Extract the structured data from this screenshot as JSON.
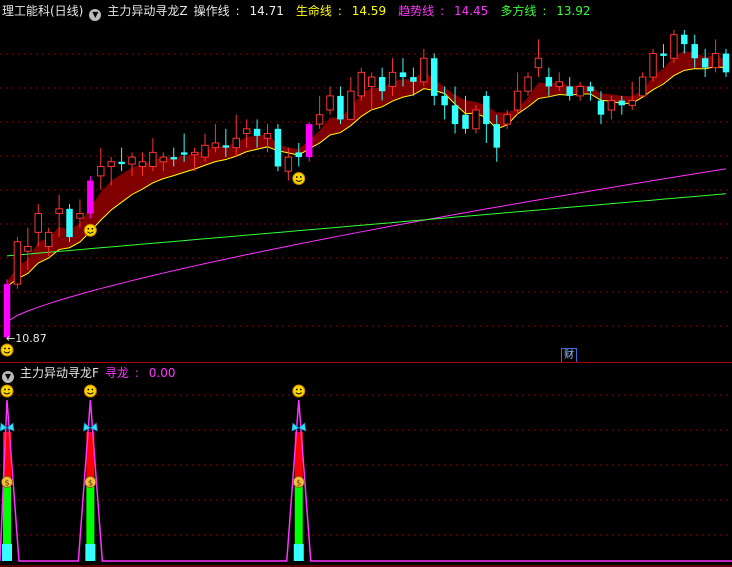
{
  "main_pane": {
    "title": "理工能科(日线)",
    "indicator_name": "主力异动寻龙Z",
    "lines": [
      {
        "label": "操作线",
        "value": "14.71",
        "color": "#f0f0f0"
      },
      {
        "label": "生命线",
        "value": "14.59",
        "color": "#ffff00"
      },
      {
        "label": "趋势线",
        "value": "14.45",
        "color": "#ff33ff"
      },
      {
        "label": "多方线",
        "value": "13.92",
        "color": "#33ff33"
      }
    ],
    "low_price_label": "10.87",
    "badge": "财"
  },
  "sub_pane": {
    "indicator_name": "主力异动寻龙F",
    "line_label": "寻龙",
    "line_value": "0.00"
  },
  "icons": {
    "dropdown": "chevron-down-icon",
    "buy_signal": "smiley-icon",
    "butterfly": "butterfly-icon",
    "money_bag": "money-bag-icon"
  },
  "colors": {
    "rising": "#ff3333",
    "falling": "#33ffff",
    "limit_up": "#ff00ff",
    "ribbon": "#800000",
    "life_line": "#ffff00",
    "trend_line": "#ff33ff",
    "multi_line": "#33ff33",
    "divider": "#b00000"
  },
  "chart_data": {
    "type": "candlestick",
    "price_range": [
      10.6,
      17.4
    ],
    "candles": [
      {
        "o": 10.87,
        "c": 12.0,
        "h": 12.1,
        "l": 10.85,
        "limit": true
      },
      {
        "o": 12.0,
        "c": 12.9,
        "h": 13.0,
        "l": 11.9
      },
      {
        "o": 12.7,
        "c": 12.8,
        "h": 13.2,
        "l": 12.3
      },
      {
        "o": 13.1,
        "c": 13.5,
        "h": 13.7,
        "l": 12.8
      },
      {
        "o": 12.8,
        "c": 13.1,
        "h": 13.2,
        "l": 12.6
      },
      {
        "o": 13.5,
        "c": 13.6,
        "h": 13.9,
        "l": 13.0
      },
      {
        "o": 13.6,
        "c": 13.0,
        "h": 13.7,
        "l": 12.9
      },
      {
        "o": 13.4,
        "c": 13.5,
        "h": 13.8,
        "l": 13.2
      },
      {
        "o": 13.5,
        "c": 14.2,
        "h": 14.3,
        "l": 13.4,
        "limit": true
      },
      {
        "o": 14.3,
        "c": 14.5,
        "h": 14.9,
        "l": 14.0
      },
      {
        "o": 14.5,
        "c": 14.6,
        "h": 14.7,
        "l": 14.1
      },
      {
        "o": 14.6,
        "c": 14.55,
        "h": 14.9,
        "l": 14.4
      },
      {
        "o": 14.55,
        "c": 14.7,
        "h": 14.8,
        "l": 14.3
      },
      {
        "o": 14.5,
        "c": 14.6,
        "h": 14.8,
        "l": 14.3
      },
      {
        "o": 14.5,
        "c": 14.8,
        "h": 15.1,
        "l": 14.4
      },
      {
        "o": 14.6,
        "c": 14.7,
        "h": 14.8,
        "l": 14.4
      },
      {
        "o": 14.7,
        "c": 14.65,
        "h": 14.9,
        "l": 14.5
      },
      {
        "o": 14.8,
        "c": 14.75,
        "h": 15.2,
        "l": 14.6
      },
      {
        "o": 14.75,
        "c": 14.8,
        "h": 14.9,
        "l": 14.4
      },
      {
        "o": 14.7,
        "c": 14.95,
        "h": 15.2,
        "l": 14.6
      },
      {
        "o": 14.9,
        "c": 15.0,
        "h": 15.4,
        "l": 14.8
      },
      {
        "o": 14.95,
        "c": 14.9,
        "h": 15.3,
        "l": 14.7
      },
      {
        "o": 14.9,
        "c": 15.1,
        "h": 15.6,
        "l": 14.7
      },
      {
        "o": 15.2,
        "c": 15.3,
        "h": 15.5,
        "l": 14.9
      },
      {
        "o": 15.3,
        "c": 15.15,
        "h": 15.5,
        "l": 14.9
      },
      {
        "o": 15.1,
        "c": 15.2,
        "h": 15.4,
        "l": 14.8
      },
      {
        "o": 15.3,
        "c": 14.5,
        "h": 15.4,
        "l": 14.4
      },
      {
        "o": 14.4,
        "c": 14.7,
        "h": 14.9,
        "l": 14.2
      },
      {
        "o": 14.8,
        "c": 14.7,
        "h": 15.0,
        "l": 14.5
      },
      {
        "o": 14.7,
        "c": 15.4,
        "h": 15.45,
        "l": 14.6,
        "limit": true
      },
      {
        "o": 15.4,
        "c": 15.6,
        "h": 16.0,
        "l": 15.3
      },
      {
        "o": 15.7,
        "c": 16.0,
        "h": 16.2,
        "l": 15.6
      },
      {
        "o": 16.0,
        "c": 15.5,
        "h": 16.2,
        "l": 15.4
      },
      {
        "o": 15.5,
        "c": 16.1,
        "h": 16.4,
        "l": 15.5
      },
      {
        "o": 16.0,
        "c": 16.5,
        "h": 16.6,
        "l": 15.9
      },
      {
        "o": 16.2,
        "c": 16.4,
        "h": 16.5,
        "l": 15.7
      },
      {
        "o": 16.4,
        "c": 16.1,
        "h": 16.6,
        "l": 15.9
      },
      {
        "o": 16.2,
        "c": 16.5,
        "h": 16.8,
        "l": 16.0
      },
      {
        "o": 16.5,
        "c": 16.4,
        "h": 16.8,
        "l": 16.2
      },
      {
        "o": 16.4,
        "c": 16.3,
        "h": 16.6,
        "l": 16.0
      },
      {
        "o": 16.3,
        "c": 16.8,
        "h": 17.0,
        "l": 16.2
      },
      {
        "o": 16.8,
        "c": 16.0,
        "h": 16.9,
        "l": 15.8
      },
      {
        "o": 16.0,
        "c": 15.8,
        "h": 16.2,
        "l": 15.5
      },
      {
        "o": 15.8,
        "c": 15.4,
        "h": 16.2,
        "l": 15.2
      },
      {
        "o": 15.6,
        "c": 15.3,
        "h": 16.0,
        "l": 15.2
      },
      {
        "o": 15.3,
        "c": 15.7,
        "h": 15.8,
        "l": 15.2
      },
      {
        "o": 16.0,
        "c": 15.4,
        "h": 16.1,
        "l": 15.0
      },
      {
        "o": 15.4,
        "c": 14.9,
        "h": 15.6,
        "l": 14.6
      },
      {
        "o": 15.4,
        "c": 15.6,
        "h": 15.7,
        "l": 15.3
      },
      {
        "o": 15.7,
        "c": 16.1,
        "h": 16.5,
        "l": 15.6
      },
      {
        "o": 16.1,
        "c": 16.4,
        "h": 16.5,
        "l": 16.0
      },
      {
        "o": 16.6,
        "c": 16.8,
        "h": 17.2,
        "l": 16.4
      },
      {
        "o": 16.4,
        "c": 16.2,
        "h": 16.6,
        "l": 16.0
      },
      {
        "o": 16.2,
        "c": 16.3,
        "h": 16.5,
        "l": 16.1
      },
      {
        "o": 16.2,
        "c": 16.0,
        "h": 16.4,
        "l": 15.9
      },
      {
        "o": 16.0,
        "c": 16.2,
        "h": 16.3,
        "l": 15.9
      },
      {
        "o": 16.2,
        "c": 16.1,
        "h": 16.3,
        "l": 15.9
      },
      {
        "o": 15.9,
        "c": 15.6,
        "h": 16.1,
        "l": 15.4
      },
      {
        "o": 15.7,
        "c": 15.9,
        "h": 16.0,
        "l": 15.5
      },
      {
        "o": 15.9,
        "c": 15.8,
        "h": 16.0,
        "l": 15.6
      },
      {
        "o": 15.8,
        "c": 15.9,
        "h": 16.3,
        "l": 15.7
      },
      {
        "o": 16.0,
        "c": 16.4,
        "h": 16.5,
        "l": 16.0
      },
      {
        "o": 16.4,
        "c": 16.9,
        "h": 17.0,
        "l": 16.3
      },
      {
        "o": 16.9,
        "c": 16.85,
        "h": 17.1,
        "l": 16.6
      },
      {
        "o": 16.8,
        "c": 17.3,
        "h": 17.4,
        "l": 16.7
      },
      {
        "o": 17.3,
        "c": 17.1,
        "h": 17.4,
        "l": 16.9
      },
      {
        "o": 17.1,
        "c": 16.8,
        "h": 17.3,
        "l": 16.6
      },
      {
        "o": 16.8,
        "c": 16.6,
        "h": 17.0,
        "l": 16.4
      },
      {
        "o": 16.6,
        "c": 16.9,
        "h": 17.2,
        "l": 16.5
      },
      {
        "o": 16.9,
        "c": 16.5,
        "h": 17.0,
        "l": 16.4
      }
    ],
    "lines": {
      "multi_line": {
        "start": 12.6,
        "end": 13.92
      },
      "trend_line": {
        "start": 11.2,
        "end": 14.45
      }
    },
    "buy_signal_bars": [
      8,
      28
    ],
    "sub_signal_bars": [
      0,
      8,
      28
    ],
    "sub_range": [
      0,
      1
    ]
  }
}
